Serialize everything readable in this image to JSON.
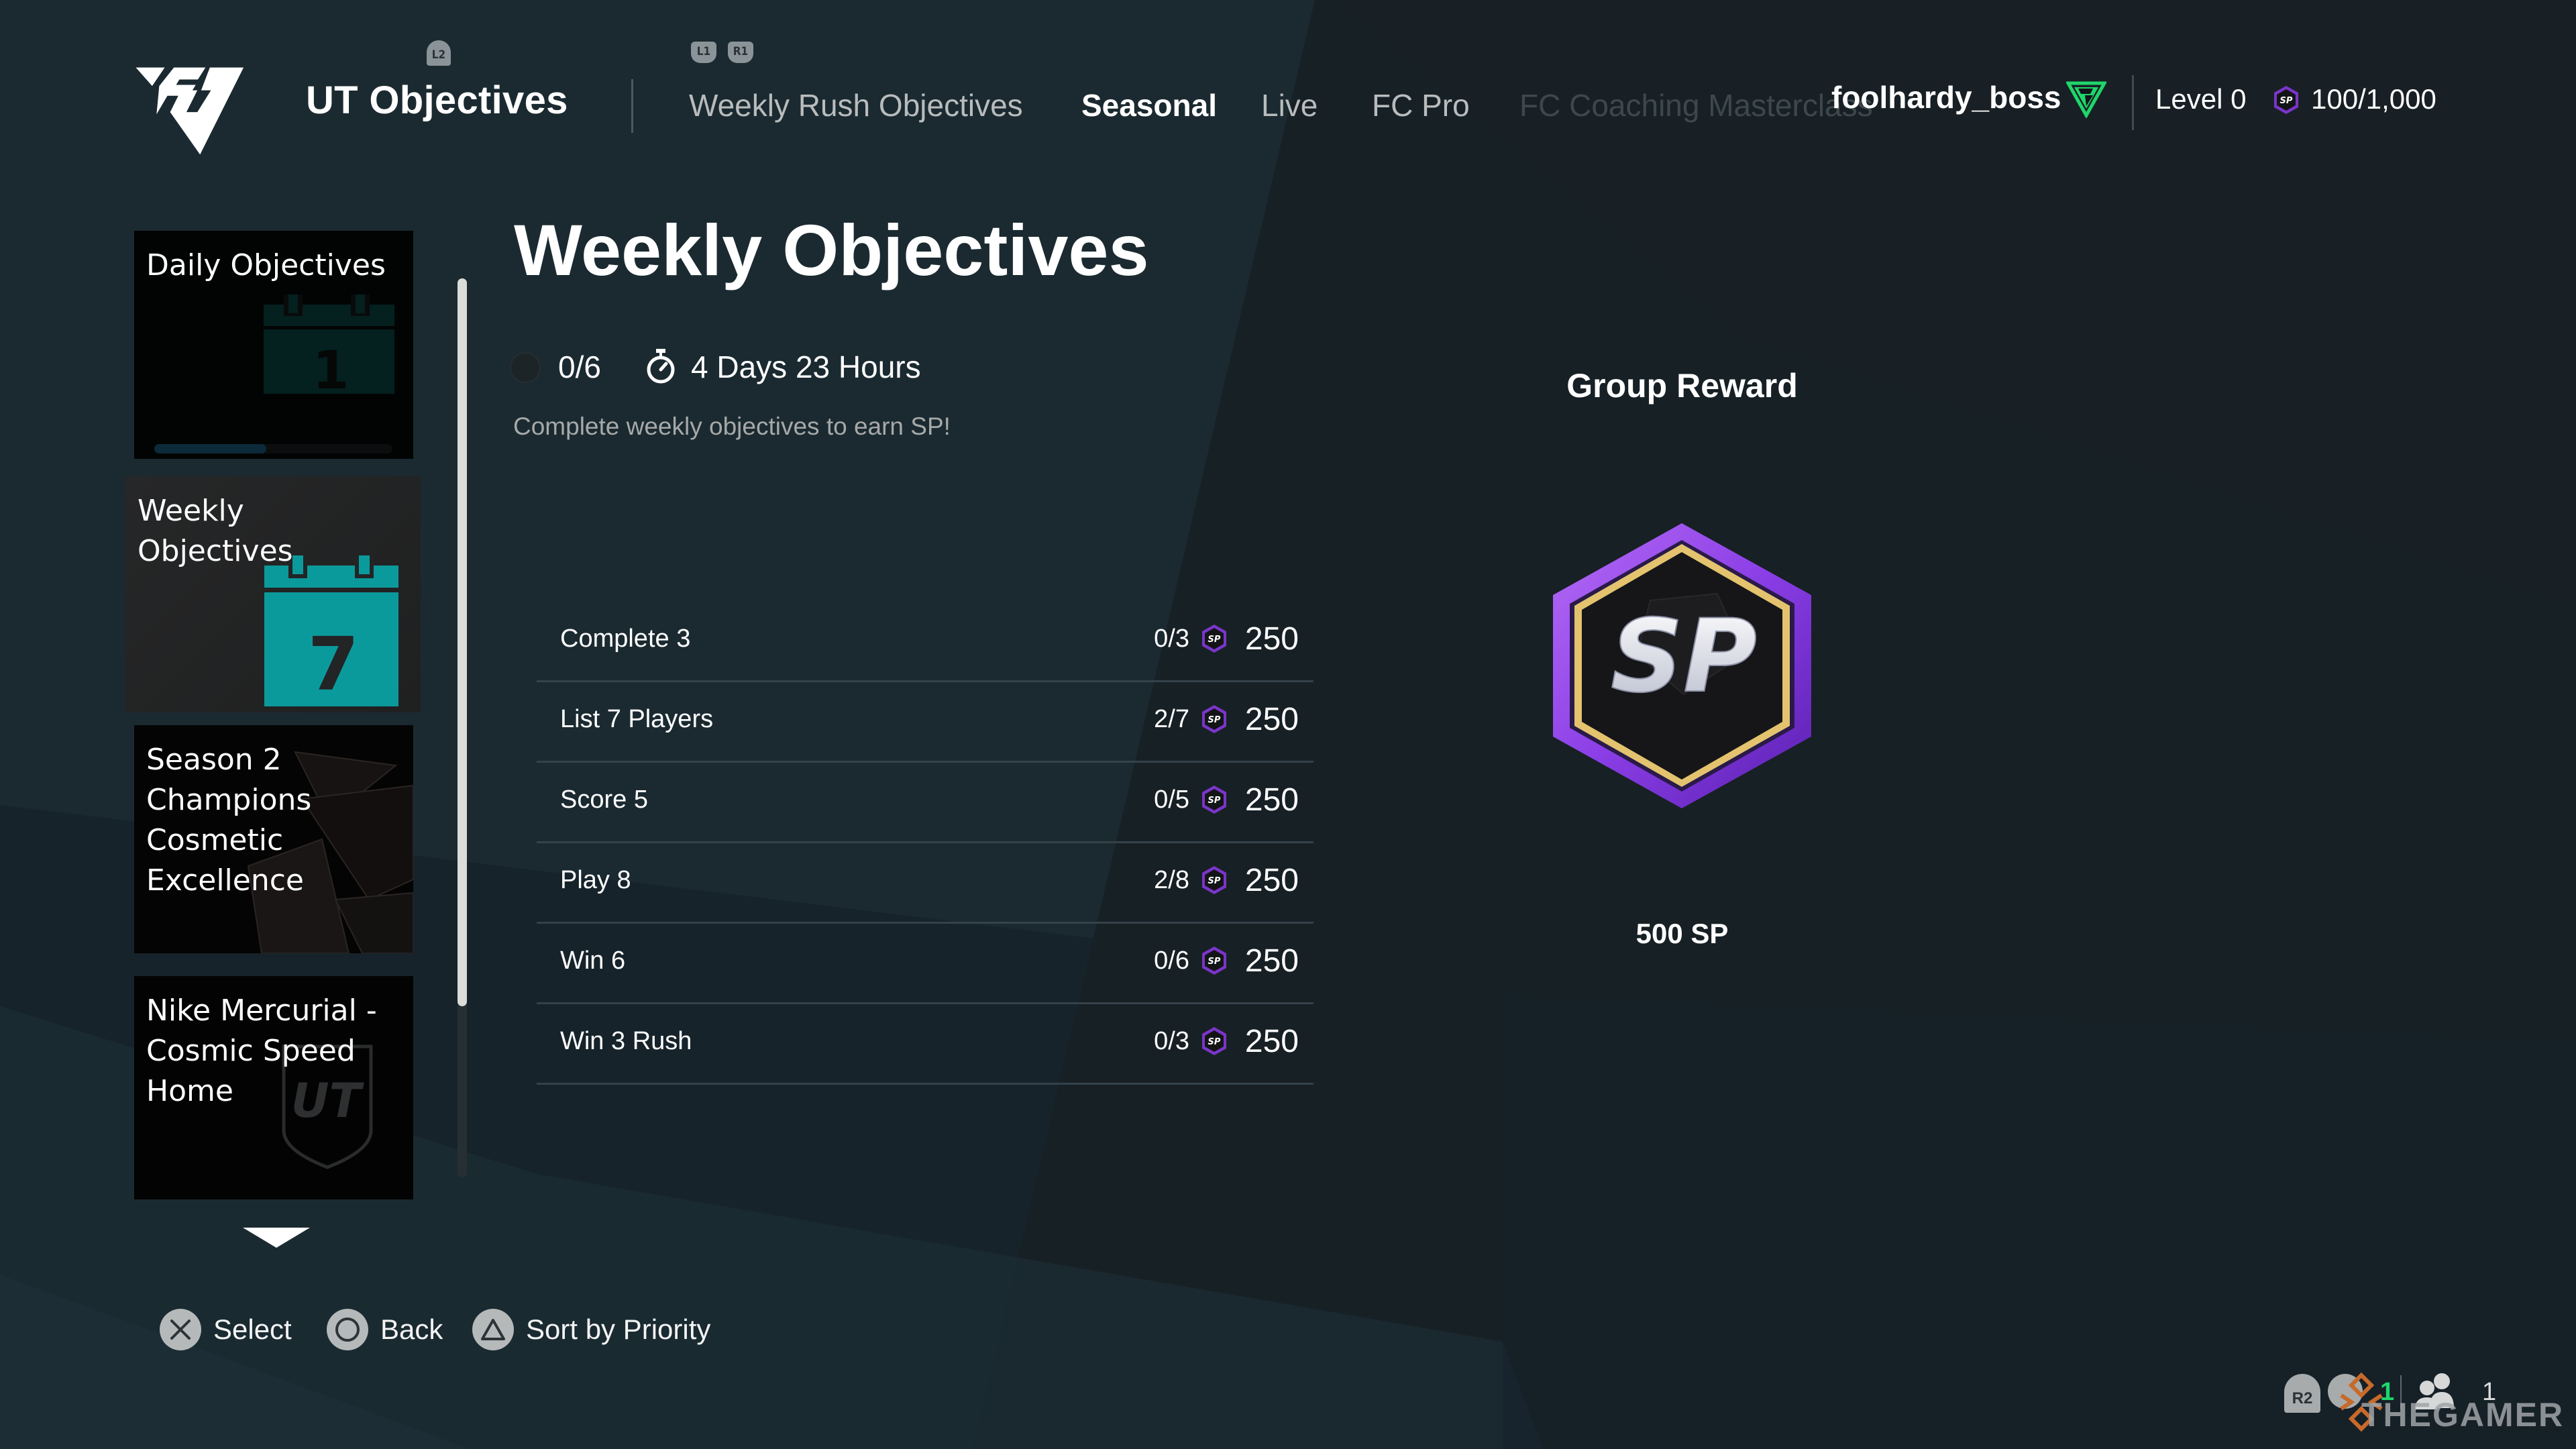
{
  "header": {
    "app_title": "UT Objectives",
    "hints": {
      "l2": "L2",
      "l1": "L1",
      "r1": "R1"
    },
    "tabs": [
      {
        "label": "Weekly Rush Objectives",
        "state": "normal"
      },
      {
        "label": "Seasonal",
        "state": "active"
      },
      {
        "label": "Live",
        "state": "normal"
      },
      {
        "label": "FC Pro",
        "state": "normal"
      },
      {
        "label": "FC Coaching Masterclass",
        "state": "faded"
      }
    ],
    "user": {
      "name": "foolhardy_boss",
      "rank_icon": "green-triangle-rank-icon",
      "level": "Level 0",
      "sp_icon": "sp-coin-icon",
      "sp_progress": "100/1,000"
    }
  },
  "sidebar": {
    "items": [
      {
        "label": "Daily Objectives",
        "icon": "calendar-day-icon",
        "calendar_number": "1",
        "progress_fraction": 0.47,
        "selected": false
      },
      {
        "label": "Weekly Objectives",
        "icon": "calendar-week-icon",
        "calendar_number": "7",
        "selected": true
      },
      {
        "label": "Season 2 Champions Cosmetic Excellence",
        "icon": "cosmetic-art-icon",
        "selected": false
      },
      {
        "label": "Nike Mercurial - Cosmic Speed Home",
        "icon": "ut-shield-icon",
        "badge_text": "UT",
        "selected": false
      }
    ],
    "scroll_position_fraction": 0.0,
    "scroll_visible_fraction": 0.81
  },
  "main": {
    "heading": "Weekly Objectives",
    "progress": "0/6",
    "time_remaining": "4 Days 23 Hours",
    "description": "Complete weekly objectives to earn SP!",
    "objectives": [
      {
        "name": "Complete 3",
        "progress": "0/3",
        "reward": "250"
      },
      {
        "name": "List 7 Players",
        "progress": "2/7",
        "reward": "250"
      },
      {
        "name": "Score 5",
        "progress": "0/5",
        "reward": "250"
      },
      {
        "name": "Play 8",
        "progress": "2/8",
        "reward": "250"
      },
      {
        "name": "Win 6",
        "progress": "0/6",
        "reward": "250"
      },
      {
        "name": "Win 3 Rush",
        "progress": "0/3",
        "reward": "250"
      }
    ]
  },
  "group_reward": {
    "title": "Group Reward",
    "badge_text": "SP",
    "amount": "500 SP"
  },
  "footer": {
    "buttons": [
      {
        "icon": "cross-button-icon",
        "label": "Select"
      },
      {
        "icon": "circle-button-icon",
        "label": "Back"
      },
      {
        "icon": "triangle-button-icon",
        "label": "Sort by Priority"
      }
    ]
  },
  "status": {
    "r2_label": "R2",
    "online_count": "1",
    "party_count": "1",
    "watermark": "THEGAMER"
  },
  "colors": {
    "background": "#18252b",
    "accent_green": "#1fd66b",
    "sp_purple": "#8a3ee6",
    "sp_gold": "#e3c36e",
    "weekly_calendar_teal": "#0b9a9c",
    "daily_calendar_dark_teal": "#04201f"
  }
}
